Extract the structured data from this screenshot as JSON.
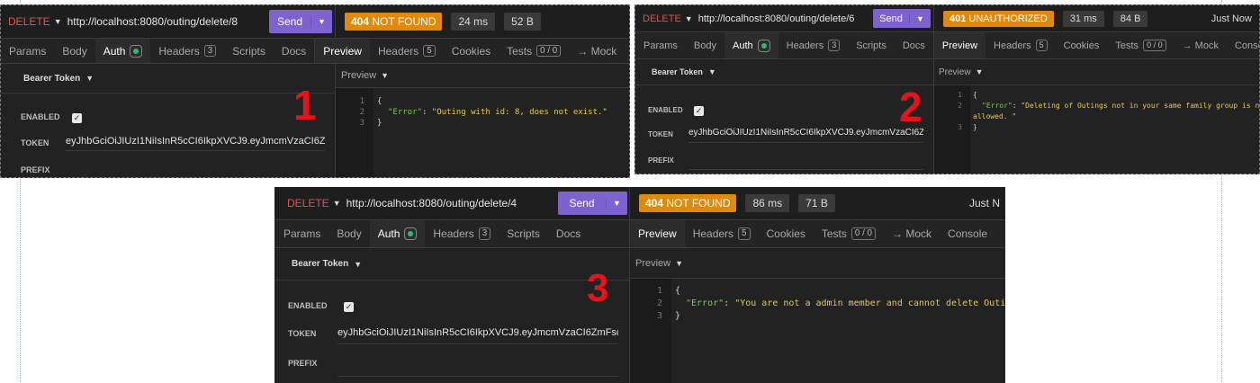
{
  "tabs": {
    "params": "Params",
    "body": "Body",
    "auth": "Auth",
    "headers": "Headers",
    "headers_count": "3",
    "scripts": "Scripts",
    "docs": "Docs",
    "preview": "Preview",
    "resp_headers": "Headers",
    "resp_headers_count": "5",
    "cookies": "Cookies",
    "tests": "Tests",
    "tests_count": "0 / 0",
    "mock": "→ Mock",
    "console": "Console",
    "console_cut": "Co"
  },
  "common": {
    "method": "DELETE",
    "send": "Send",
    "bearer": "Bearer Token",
    "preview_label": "Preview",
    "enabled": "ENABLED",
    "token_label": "TOKEN",
    "prefix": "PREFIX",
    "token_value": "eyJhbGciOiJIUzI1NiIsInR5cCI6IkpXVCJ9.eyJmcmVzaCI6ZmFsc"
  },
  "screens": [
    {
      "label": "1",
      "url": "http://localhost:8080/outing/delete/8",
      "status_code": "404",
      "status_text": "NOT FOUND",
      "time": "24 ms",
      "size": "52 B",
      "error_key": "\"Error\"",
      "error_line1": "\"Outing with id: 8, does not exist.\"",
      "error_line2": ""
    },
    {
      "label": "2",
      "url": "http://localhost:8080/outing/delete/6",
      "status_code": "401",
      "status_text": "UNAUTHORIZED",
      "time": "31 ms",
      "size": "84 B",
      "just_now": "Just Now",
      "error_key": "\"Error\"",
      "error_line1": "\"Deleting of Outings not in your same family group is not",
      "error_line2": "allowed. \""
    },
    {
      "label": "3",
      "url": "http://localhost:8080/outing/delete/4",
      "status_code": "404",
      "status_text": "NOT FOUND",
      "time": "86 ms",
      "size": "71 B",
      "just_now": "Just N",
      "error_key": "\"Error\"",
      "error_line1": "\"You are not a admin member and cannot delete Outings.\"",
      "error_line2": ""
    }
  ],
  "code_lines": [
    "1",
    "2",
    "3"
  ],
  "json_open": "{",
  "json_close": "}"
}
